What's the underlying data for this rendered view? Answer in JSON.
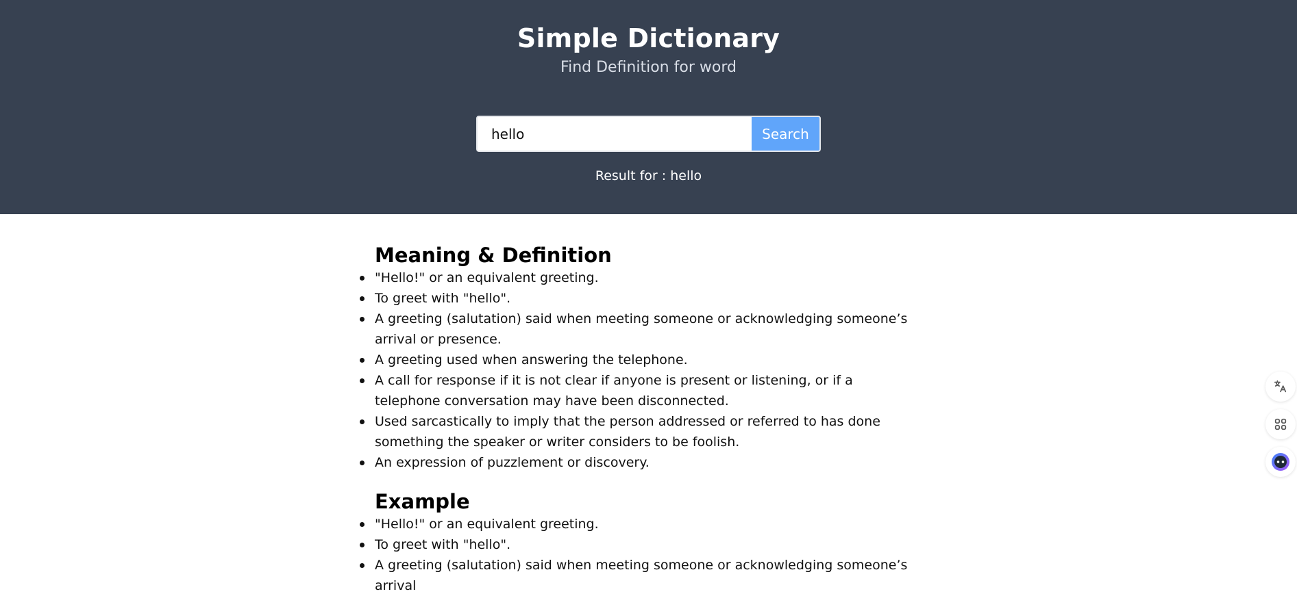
{
  "header": {
    "title": "Simple Dictionary",
    "subtitle": "Find Definition for word",
    "search_value": "hello",
    "search_placeholder": "",
    "search_button": "Search",
    "result_text": "Result for : hello"
  },
  "meaning": {
    "heading": "Meaning & Definition",
    "items": [
      "\"Hello!\" or an equivalent greeting.",
      "To greet with \"hello\".",
      "A greeting (salutation) said when meeting someone or acknowledging someone’s arrival or presence.",
      "A greeting used when answering the telephone.",
      "A call for response if it is not clear if anyone is present or listening, or if a telephone conversation may have been disconnected.",
      "Used sarcastically to imply that the person addressed or referred to has done something the speaker or writer considers to be foolish.",
      "An expression of puzzlement or discovery."
    ]
  },
  "example": {
    "heading": "Example",
    "items": [
      "\"Hello!\" or an equivalent greeting.",
      "To greet with \"hello\".",
      "A greeting (salutation) said when meeting someone or acknowledging someone’s arrival"
    ]
  },
  "floating_tools": {
    "icons": [
      "translate-icon",
      "apps-grid-icon",
      "assistant-icon"
    ]
  },
  "colors": {
    "header_bg": "#374151",
    "button_bg": "#60a5fa"
  }
}
